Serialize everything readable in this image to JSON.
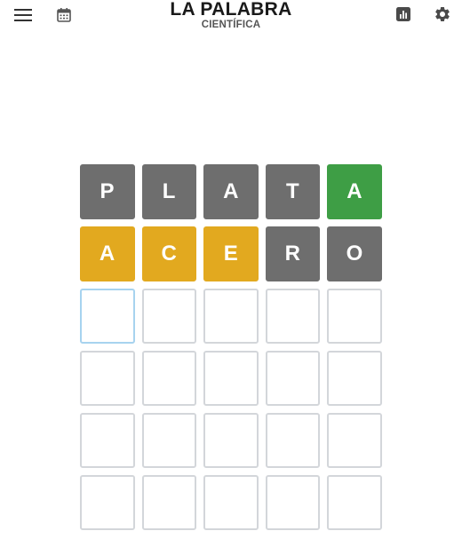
{
  "header": {
    "title": "LA PALABRA",
    "subtitle": "CIENTÍFICA",
    "icons": {
      "menu": "hamburger-menu-icon",
      "calendar": "calendar-icon",
      "stats": "bar-chart-icon",
      "settings": "gear-icon"
    }
  },
  "colors": {
    "absent": "#6e6e6e",
    "present": "#e2a91f",
    "correct": "#3e9e45",
    "empty_border": "#d3d6da",
    "active_border": "#a7d3ef"
  },
  "board": {
    "rows": [
      [
        {
          "letter": "P",
          "state": "absent"
        },
        {
          "letter": "L",
          "state": "absent"
        },
        {
          "letter": "A",
          "state": "absent"
        },
        {
          "letter": "T",
          "state": "absent"
        },
        {
          "letter": "A",
          "state": "correct"
        }
      ],
      [
        {
          "letter": "A",
          "state": "present"
        },
        {
          "letter": "C",
          "state": "present"
        },
        {
          "letter": "E",
          "state": "present"
        },
        {
          "letter": "R",
          "state": "absent"
        },
        {
          "letter": "O",
          "state": "absent"
        }
      ],
      [
        {
          "letter": "",
          "state": "active"
        },
        {
          "letter": "",
          "state": "empty"
        },
        {
          "letter": "",
          "state": "empty"
        },
        {
          "letter": "",
          "state": "empty"
        },
        {
          "letter": "",
          "state": "empty"
        }
      ],
      [
        {
          "letter": "",
          "state": "empty"
        },
        {
          "letter": "",
          "state": "empty"
        },
        {
          "letter": "",
          "state": "empty"
        },
        {
          "letter": "",
          "state": "empty"
        },
        {
          "letter": "",
          "state": "empty"
        }
      ],
      [
        {
          "letter": "",
          "state": "empty"
        },
        {
          "letter": "",
          "state": "empty"
        },
        {
          "letter": "",
          "state": "empty"
        },
        {
          "letter": "",
          "state": "empty"
        },
        {
          "letter": "",
          "state": "empty"
        }
      ],
      [
        {
          "letter": "",
          "state": "empty"
        },
        {
          "letter": "",
          "state": "empty"
        },
        {
          "letter": "",
          "state": "empty"
        },
        {
          "letter": "",
          "state": "empty"
        },
        {
          "letter": "",
          "state": "empty"
        }
      ]
    ]
  }
}
